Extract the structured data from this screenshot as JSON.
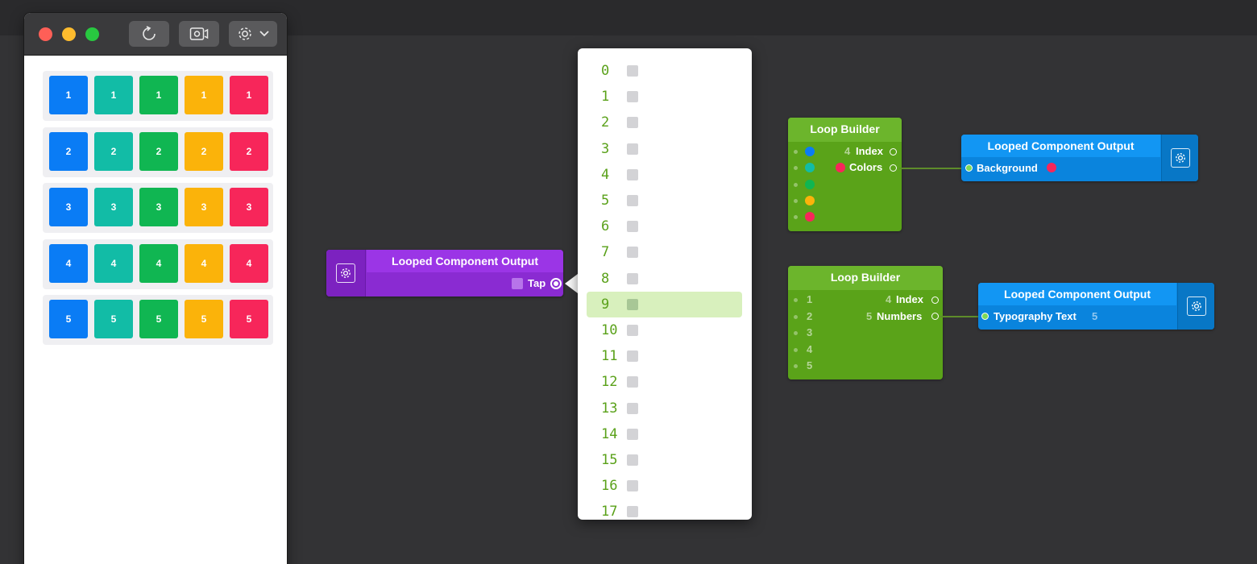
{
  "prototype": {
    "toolbar": {
      "reload_icon": "reload-icon",
      "record_icon": "record-icon",
      "settings_icon": "gear-icon"
    },
    "grid_colors": [
      "#0a7cf5",
      "#12bca6",
      "#10b652",
      "#fbb30a",
      "#f7265a"
    ],
    "rows": [
      [
        "1",
        "1",
        "1",
        "1",
        "1"
      ],
      [
        "2",
        "2",
        "2",
        "2",
        "2"
      ],
      [
        "3",
        "3",
        "3",
        "3",
        "3"
      ],
      [
        "4",
        "4",
        "4",
        "4",
        "4"
      ],
      [
        "5",
        "5",
        "5",
        "5",
        "5"
      ]
    ]
  },
  "tap_node": {
    "title": "Looped Component Output",
    "port_label": "Tap"
  },
  "picker": {
    "items": [
      "0",
      "1",
      "2",
      "3",
      "4",
      "5",
      "6",
      "7",
      "8",
      "9",
      "10",
      "11",
      "12",
      "13",
      "14",
      "15",
      "16",
      "17"
    ],
    "selected": "9"
  },
  "loop_builder_colors": {
    "title": "Loop Builder",
    "inputs": [
      "#0a7cf5",
      "#12bca6",
      "#10b652",
      "#fbb30a",
      "#f7265a"
    ],
    "index_count": "4",
    "index_label": "Index",
    "colors_label": "Colors",
    "colors_value": "#f7265a"
  },
  "output_background": {
    "title": "Looped Component Output",
    "port_label": "Background",
    "value_color": "#f7265a"
  },
  "loop_builder_numbers": {
    "title": "Loop Builder",
    "inputs": [
      "1",
      "2",
      "3",
      "4",
      "5"
    ],
    "index_count": "4",
    "index_label": "Index",
    "numbers_count": "5",
    "numbers_label": "Numbers"
  },
  "output_typography": {
    "title": "Looped Component Output",
    "port_label": "Typography Text",
    "value": "5"
  }
}
